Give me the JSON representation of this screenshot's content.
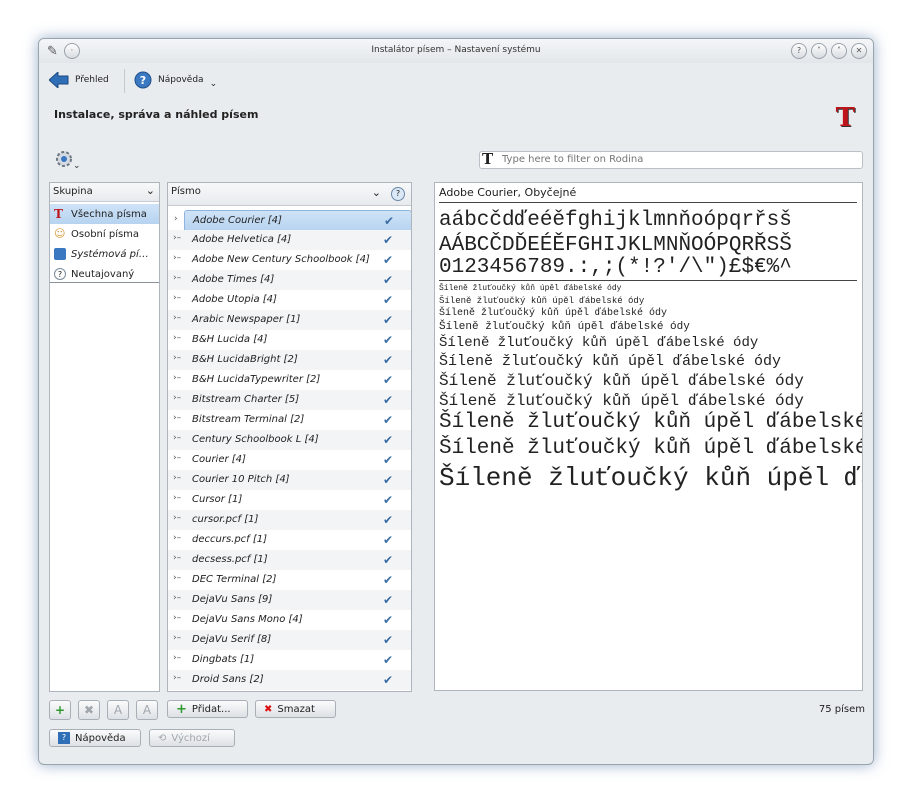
{
  "window": {
    "title": "Instalátor písem – Nastavení systému"
  },
  "nav": {
    "overview": "Přehled",
    "help": "Nápověda"
  },
  "heading": "Instalace, správa a náhled písem",
  "filter": {
    "placeholder": "Type here to filter on Rodina"
  },
  "groups": {
    "header": "Skupina",
    "items": [
      {
        "label": "Všechna písma",
        "icon": "font-icon"
      },
      {
        "label": "Osobní písma",
        "icon": "user-icon"
      },
      {
        "label": "Systémová pí…",
        "icon": "system-icon"
      },
      {
        "label": "Neutajovaný",
        "icon": "help-icon"
      }
    ]
  },
  "fonts": {
    "header": "Písmo",
    "items": [
      "Adobe Courier [4]",
      "Adobe Helvetica [4]",
      "Adobe New Century Schoolbook [4]",
      "Adobe Times [4]",
      "Adobe Utopia [4]",
      "Arabic Newspaper [1]",
      "B&H Lucida [4]",
      "B&H LucidaBright [2]",
      "B&H LucidaTypewriter [2]",
      "Bitstream Charter [5]",
      "Bitstream Terminal [2]",
      "Century Schoolbook L [4]",
      "Courier [4]",
      "Courier 10 Pitch [4]",
      "Cursor [1]",
      "cursor.pcf [1]",
      "deccurs.pcf [1]",
      "decsess.pcf [1]",
      "DEC Terminal [2]",
      "DejaVu Sans [9]",
      "DejaVu Sans Mono [4]",
      "DejaVu Serif [8]",
      "Dingbats [1]",
      "Droid Sans [2]"
    ]
  },
  "preview": {
    "title": "Adobe Courier, Obyčejné",
    "lower": "aábcčdďeéěfghijklmnňoópqrřsš",
    "upper": "AÁBCČDĎEÉĚFGHIJKLMNŇOÓPQRŘSŠ",
    "digits": "0123456789.:,;(*!?'/\\\")£$€%^",
    "sample": "Šíleně žluťoučký kůň úpěl ďábelské ódy"
  },
  "buttons": {
    "add": "Přidat...",
    "delete": "Smazat",
    "help": "Nápověda",
    "defaults": "Výchozí"
  },
  "status": {
    "count": "75 písem"
  },
  "colors": {
    "selection": "#b6d3f0",
    "check": "#3a6ea5",
    "logo": "#c0141b"
  }
}
